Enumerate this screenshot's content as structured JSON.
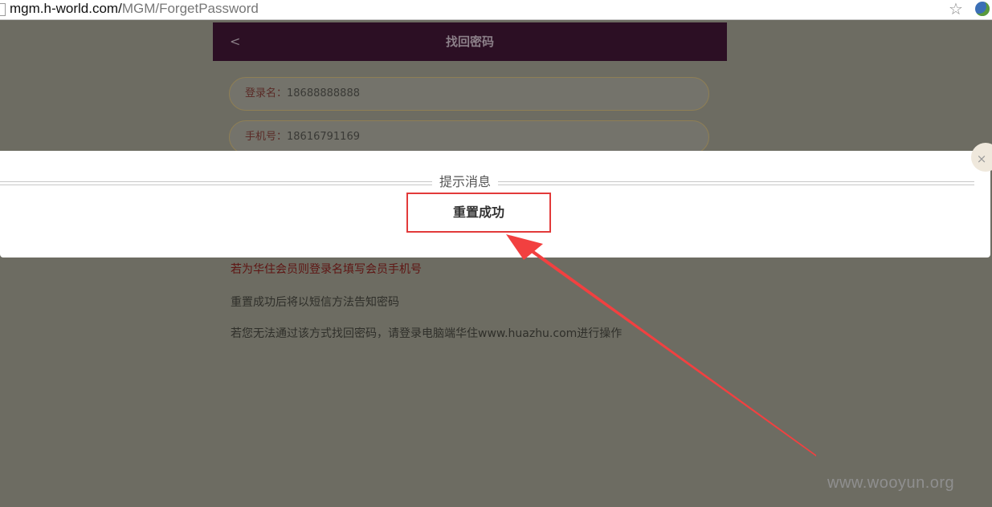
{
  "browser": {
    "url_host": "mgm.h-world.com/",
    "url_path": "MGM/ForgetPassword",
    "star_icon": "☆"
  },
  "header": {
    "back_label": "<",
    "title": "找回密码"
  },
  "form": {
    "login_label": "登录名：",
    "login_value": "18688888888",
    "phone_label": "手机号：",
    "phone_value": "18616791169"
  },
  "notes": {
    "red_note": "若为华住会员则登录名填写会员手机号",
    "note_sms": "重置成功后将以短信方法告知密码",
    "note_pc": "若您无法通过该方式找回密码，请登录电脑端华住www.huazhu.com进行操作"
  },
  "dialog": {
    "caption": "提示消息",
    "message": "重置成功",
    "close_label": "×"
  },
  "annotation": {
    "arrow_color": "#f24040",
    "box_color": "#e23a3a"
  },
  "watermark": "www.wooyun.org"
}
